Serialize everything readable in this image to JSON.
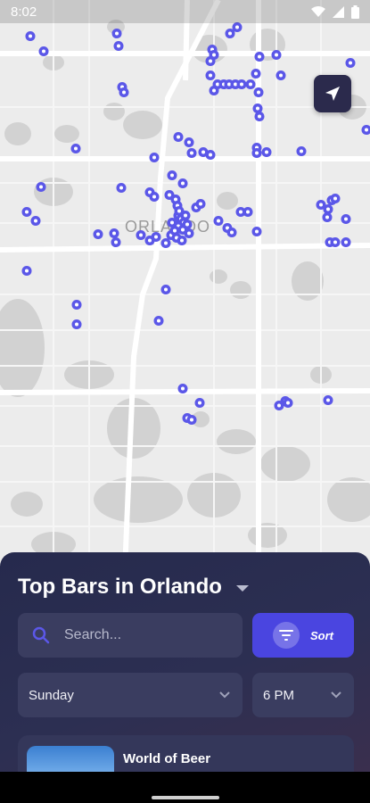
{
  "status": {
    "time": "8:02"
  },
  "map": {
    "city_label": "ORLANDO"
  },
  "sheet": {
    "title": "Top Bars in Orlando",
    "search_placeholder": "Search...",
    "sort_label": "Sort",
    "day_value": "Sunday",
    "time_value": "6 PM"
  },
  "card": {
    "title": "World of Beer",
    "subtitle": ""
  },
  "colors": {
    "accent": "#4a45e0",
    "pin": "#5b57e8",
    "sheet_bg": "#2a2d50"
  }
}
